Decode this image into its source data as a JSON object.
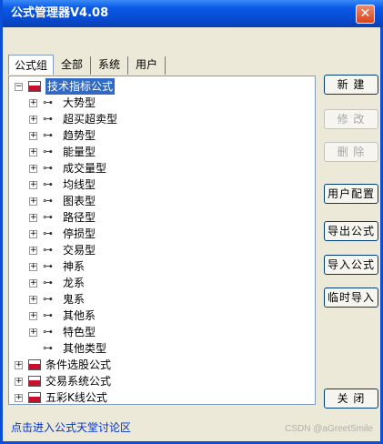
{
  "window": {
    "title": "公式管理器V4.08",
    "close_glyph": "✕"
  },
  "tabs": [
    {
      "label": "公式组"
    },
    {
      "label": "全部"
    },
    {
      "label": "系统"
    },
    {
      "label": "用户"
    }
  ],
  "tree": {
    "root": "技术指标公式",
    "children": [
      "大势型",
      "超买超卖型",
      "趋势型",
      "能量型",
      "成交量型",
      "均线型",
      "图表型",
      "路径型",
      "停损型",
      "交易型",
      "神系",
      "龙系",
      "鬼系",
      "其他系",
      "特色型",
      "其他类型"
    ],
    "groups": [
      "条件选股公式",
      "交易系统公式",
      "五彩K线公式"
    ]
  },
  "buttons": {
    "new": "新 建",
    "edit": "修 改",
    "delete": "删 除",
    "user_config": "用户配置",
    "export": "导出公式",
    "import": "导入公式",
    "temp_import": "临时导入",
    "close": "关 闭"
  },
  "footer": {
    "link": "点击进入公式天堂讨论区",
    "watermark": "CSDN @aGreetSmile"
  }
}
